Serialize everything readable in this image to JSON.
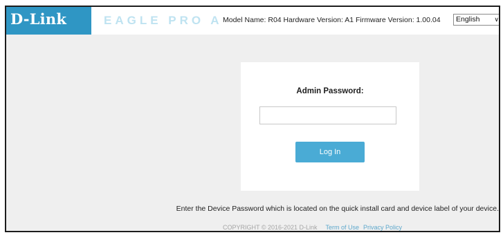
{
  "header": {
    "logo": "D-Link",
    "product": "EAGLE PRO AI",
    "model_info": "Model Name: R04 Hardware Version: A1 Firmware Version: 1.00.04",
    "language": "English",
    "accent_color": "#2f96c4"
  },
  "login": {
    "label": "Admin Password:",
    "password_value": "",
    "button_label": "Log In",
    "button_color": "#4aabd5"
  },
  "hint": "Enter the Device Password which is located on the quick install card and device label of your device.",
  "footer": {
    "copyright": "COPYRIGHT © 2016-2021 D-Link",
    "terms": "Term of Use",
    "privacy": "Privacy Policy"
  }
}
